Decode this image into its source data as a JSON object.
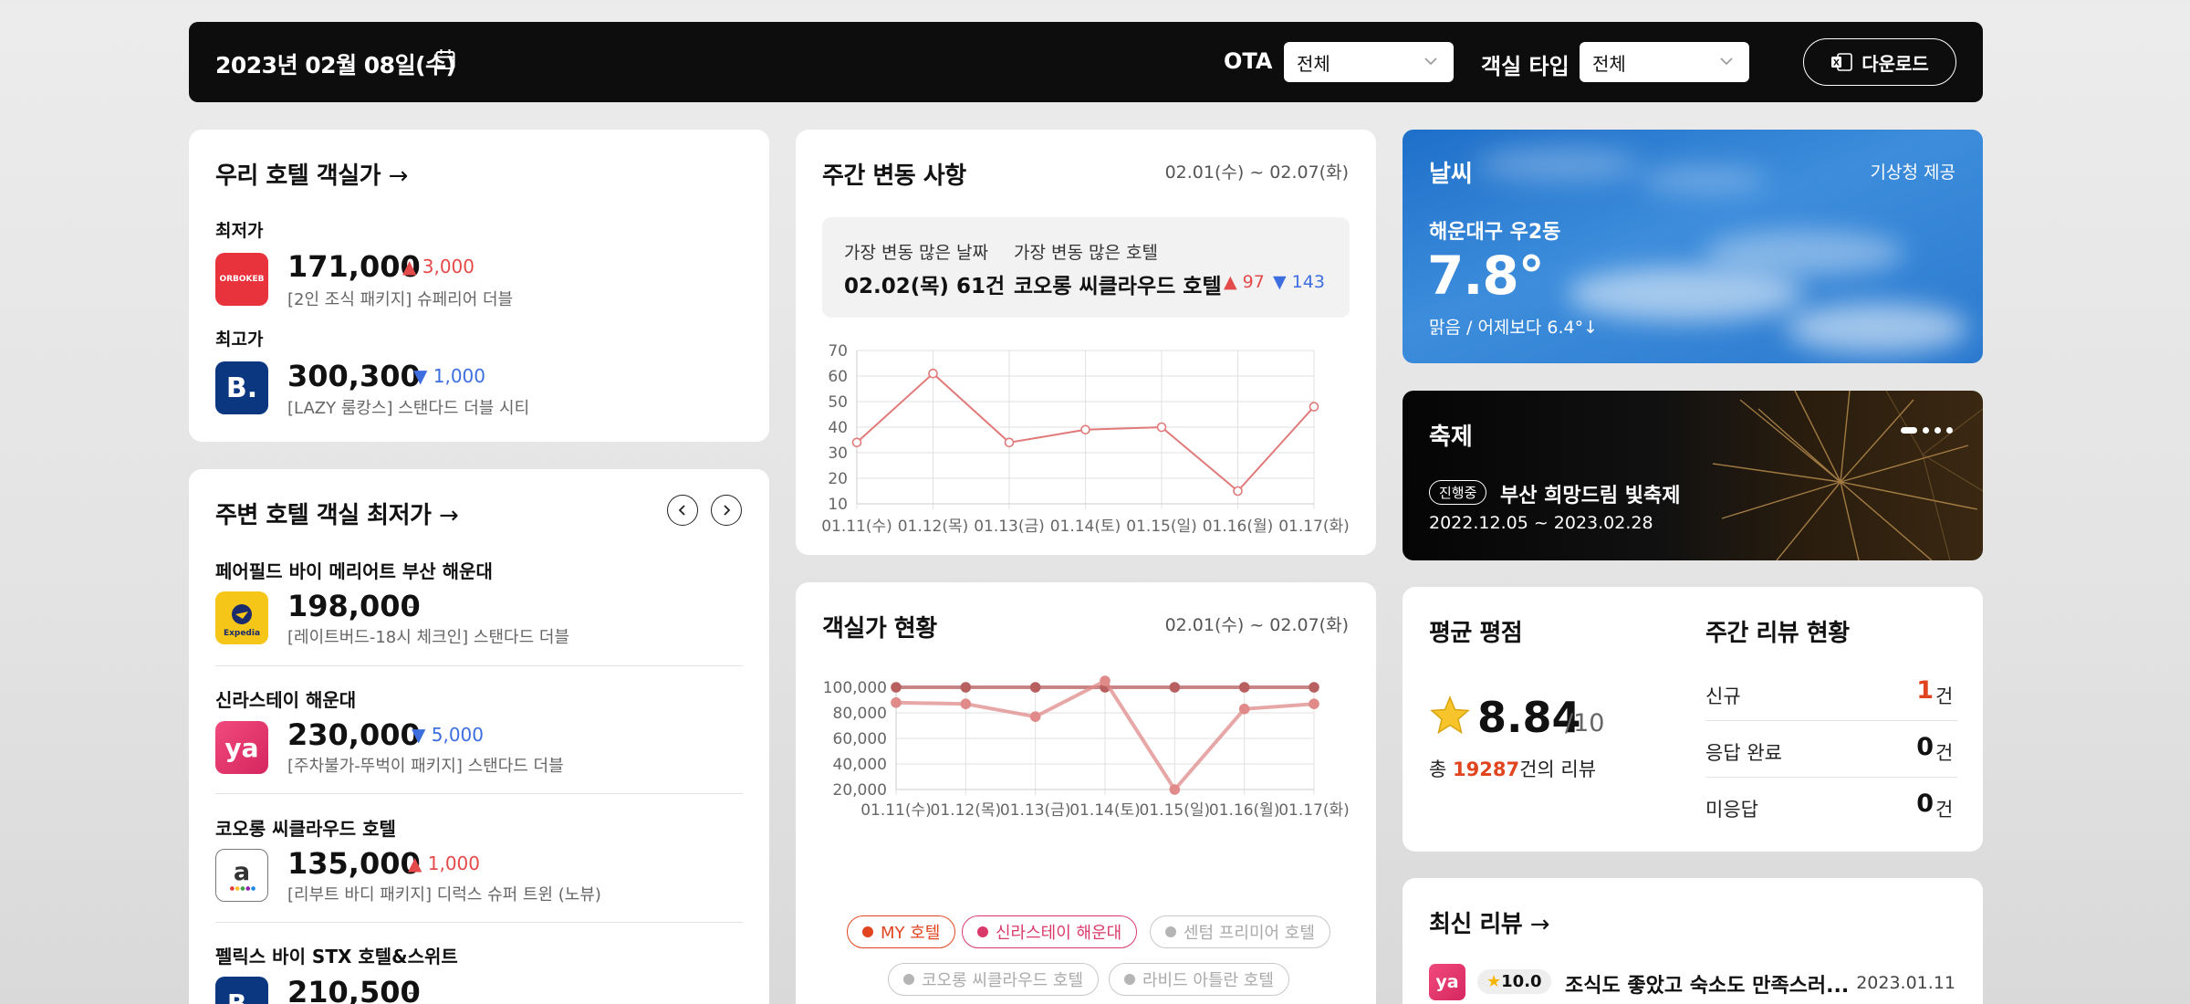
{
  "topbar": {
    "date": "2023년 02월 08일(수)",
    "ota_label": "OTA",
    "ota_value": "전체",
    "room_type_label": "객실 타입",
    "room_type_value": "전체",
    "download_label": "다운로드"
  },
  "our_rates": {
    "title": "우리 호텔 객실가",
    "lowest_label": "최저가",
    "lowest": {
      "logo_text": "ORBOKEB",
      "price": "171,000",
      "delta": "3,000",
      "direction": "up",
      "desc": "[2인 조식 패키지] 슈페리어 더블"
    },
    "highest_label": "최고가",
    "highest": {
      "logo_text": "B.",
      "price": "300,300",
      "delta": "1,000",
      "direction": "down",
      "desc": "[LAZY 룸캉스] 스탠다드 더블 시티"
    }
  },
  "nearby": {
    "title": "주변 호텔 객실 최저가",
    "items": [
      {
        "name": "페어필드 바이 메리어트 부산 해운대",
        "logo": "Expedia",
        "price": "198,000",
        "delta": "-",
        "direction": "none",
        "desc": "[레이트버드-18시 체크인] 스탠다드 더블"
      },
      {
        "name": "신라스테이 해운대",
        "logo": "ya",
        "price": "230,000",
        "delta": "5,000",
        "direction": "down",
        "desc": "[주차불가-뚜벅이 패키지] 스탠다드 더블"
      },
      {
        "name": "코오롱 씨클라우드 호텔",
        "logo": "a",
        "price": "135,000",
        "delta": "1,000",
        "direction": "up",
        "desc": "[리부트 바디 패키지] 디럭스 슈퍼 트윈 (노뷰)"
      },
      {
        "name": "펠릭스 바이 STX 호텔&스위트",
        "logo": "B.",
        "price": "210,500",
        "delta": "-",
        "direction": "none",
        "desc": ""
      }
    ]
  },
  "weekly": {
    "title": "주간 변동 사항",
    "range": "02.01(수) ~ 02.07(화)",
    "most_date_label": "가장 변동 많은 날짜",
    "most_date_value": "02.02(목) 61건",
    "most_hotel_label": "가장 변동 많은 호텔",
    "most_hotel_value": "코오롱 씨클라우드 호텔",
    "most_hotel_up": "97",
    "most_hotel_down": "143"
  },
  "rates_status": {
    "title": "객실가 현황",
    "range": "02.01(수) ~ 02.07(화)",
    "legend": [
      {
        "label": "MY 호텔",
        "color": "#e0451f",
        "active": true
      },
      {
        "label": "신라스테이 해운대",
        "color": "#d93a6a",
        "active": true
      },
      {
        "label": "센텀 프리미어 호텔",
        "color": "#b5b5b5",
        "active": false
      },
      {
        "label": "코오롱 씨클라우드 호텔",
        "color": "#b5b5b5",
        "active": false
      },
      {
        "label": "라비드 아틀란 호텔",
        "color": "#b5b5b5",
        "active": false
      }
    ]
  },
  "weather": {
    "title": "날씨",
    "provider": "기상청 제공",
    "location": "해운대구 우2동",
    "temp": "7.8°",
    "summary": "맑음 / 어제보다 6.4°↓"
  },
  "festival": {
    "title": "축제",
    "badge": "진행중",
    "name": "부산 희망드림 빛축제",
    "period": "2022.12.05 ~ 2023.02.28"
  },
  "rating": {
    "title": "평균 평점",
    "score": "8.84",
    "max": "/10",
    "total_prefix": "총 ",
    "total_count": "19287",
    "total_suffix": "건의 리뷰"
  },
  "weekly_reviews": {
    "title": "주간 리뷰 현황",
    "rows": [
      {
        "label": "신규",
        "value": "1",
        "unit": "건"
      },
      {
        "label": "응답 완료",
        "value": "0",
        "unit": "건"
      },
      {
        "label": "미응답",
        "value": "0",
        "unit": "건"
      }
    ]
  },
  "latest_reviews": {
    "title": "최신 리뷰",
    "items": [
      {
        "logo": "ya",
        "score": "10.0",
        "text": "조식도 좋았고 숙소도 만족스러...",
        "date": "2023.01.11"
      }
    ]
  },
  "chart_data": [
    {
      "type": "line",
      "title": "",
      "categories": [
        "01.11(수)",
        "01.12(목)",
        "01.13(금)",
        "01.14(토)",
        "01.15(일)",
        "01.16(월)",
        "01.17(화)"
      ],
      "series": [
        {
          "values": [
            34,
            61,
            34,
            39,
            40,
            15,
            48
          ],
          "color": "#e07a7a"
        }
      ],
      "ylim": [
        10,
        70
      ],
      "yticks": [
        "10",
        "20",
        "30",
        "40",
        "50",
        "60",
        "70"
      ],
      "grid": true
    },
    {
      "type": "line",
      "title": "",
      "categories": [
        "01.11(수)",
        "01.12(목)",
        "01.13(금)",
        "01.14(토)",
        "01.15(일)",
        "01.16(월)",
        "01.17(화)"
      ],
      "series": [
        {
          "name": "MY 호텔",
          "values": [
            100000,
            100000,
            100000,
            100000,
            100000,
            100000,
            100000
          ],
          "color": "#b86060"
        },
        {
          "name": "신라스테이 해운대",
          "values": [
            88000,
            87000,
            77000,
            105000,
            20000,
            83000,
            87000
          ],
          "color": "#e08a8a"
        }
      ],
      "ylim": [
        20000,
        100000
      ],
      "yticks": [
        "20,000",
        "40,000",
        "60,000",
        "80,000",
        "100,000"
      ],
      "grid": true
    }
  ]
}
